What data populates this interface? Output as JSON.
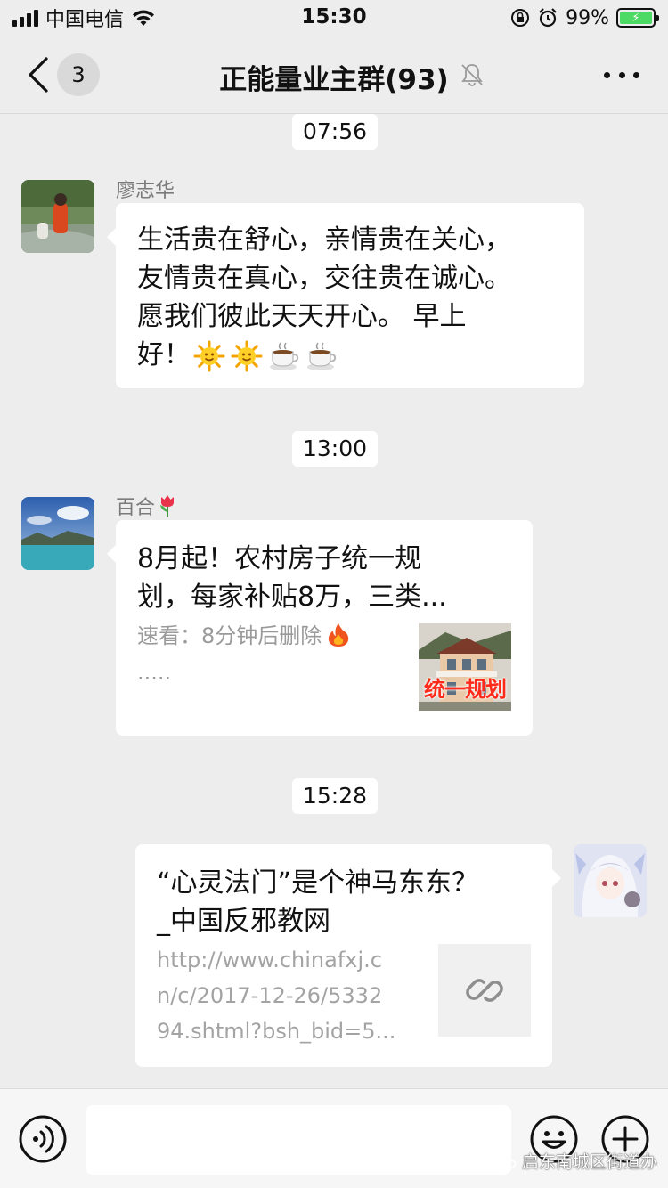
{
  "status_bar": {
    "carrier": "中国电信",
    "time": "15:30",
    "battery_percent": "99%"
  },
  "nav": {
    "unread_count": "3",
    "title": "正能量业主群(93)"
  },
  "messages": [
    {
      "time": "07:56",
      "sender": "廖志华",
      "type": "text",
      "lines": [
        "生活贵在舒心，亲情贵在关心，",
        "友情贵在真心，交往贵在诚心。",
        "愿我们彼此天天开心。 早上",
        "好！"
      ],
      "emojis": [
        "sun-emoji",
        "sun-emoji",
        "coffee-emoji",
        "coffee-emoji"
      ]
    },
    {
      "time": "13:00",
      "sender": "百合",
      "sender_emoji": "tulip-emoji",
      "type": "article",
      "title_lines": [
        "8月起！农村房子统一规",
        "划，每家补贴8万，三类..."
      ],
      "desc_lines": [
        "速看：8分钟后删除",
        "....."
      ],
      "thumb_caption": "统一规划"
    },
    {
      "time": "15:28",
      "sender": "me",
      "type": "link",
      "title_lines": [
        "“心灵法门”是个神马东东？",
        "_中国反邪教网"
      ],
      "url_lines": [
        "http://www.chinafxj.c",
        "n/c/2017-12-26/5332",
        "94.shtml?bsh_bid=5..."
      ]
    }
  ],
  "input_bar": {
    "placeholder": ""
  },
  "watermark": "启东南城区街道办",
  "colors": {
    "background": "#ededed",
    "bubble": "#ffffff",
    "battery": "#4cd964",
    "timestamp_bg": "#ffffff"
  }
}
